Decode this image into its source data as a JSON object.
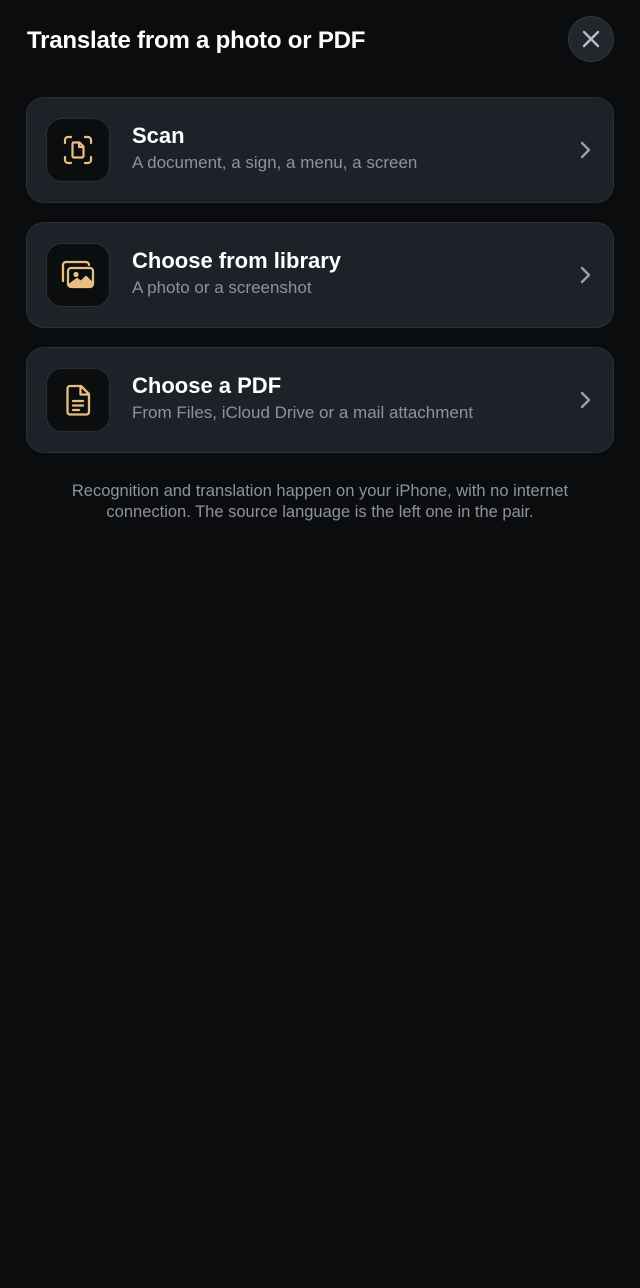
{
  "header": {
    "title": "Translate from a photo or PDF",
    "close_icon": "close-icon"
  },
  "options": [
    {
      "icon": "scan-document-icon",
      "title": "Scan",
      "subtitle": "A document, a sign, a menu, a screen"
    },
    {
      "icon": "photo-library-icon",
      "title": "Choose from library",
      "subtitle": "A photo or a screenshot"
    },
    {
      "icon": "document-icon",
      "title": "Choose a PDF",
      "subtitle": "From Files, iCloud Drive or a mail attachment"
    }
  ],
  "footnote": "Recognition and translation happen on your iPhone, with no internet connection. The source language is the left one in the pair.",
  "colors": {
    "background": "#0b0c0e",
    "card": "#1d2128",
    "accent_icon": "#e8bf82",
    "secondary_text": "#8d939c"
  }
}
